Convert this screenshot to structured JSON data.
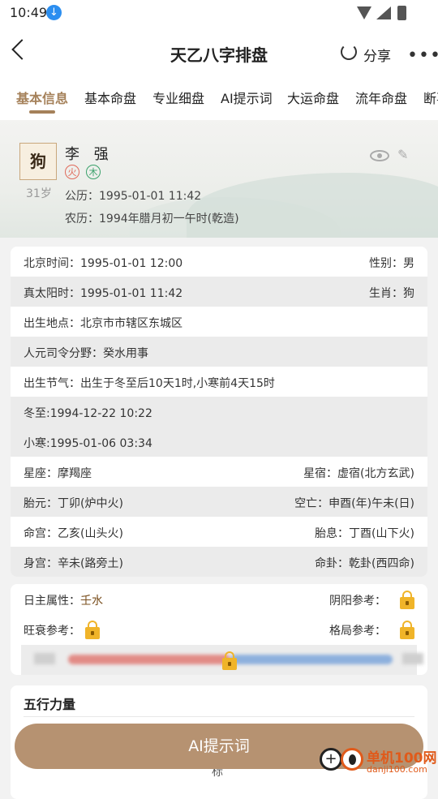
{
  "status_bar": {
    "time": "10:49"
  },
  "header": {
    "title": "天乙八字排盘",
    "share_label": "分享"
  },
  "tabs": [
    {
      "label": "基本信息"
    },
    {
      "label": "基本命盘"
    },
    {
      "label": "专业细盘"
    },
    {
      "label": "AI提示词"
    },
    {
      "label": "大运命盘"
    },
    {
      "label": "流年命盘"
    },
    {
      "label": "断事"
    }
  ],
  "profile": {
    "avatar_text": "狗",
    "age": "31岁",
    "name": "李 强",
    "elements": [
      "火",
      "木"
    ],
    "solar": "公历：1995-01-01 11:42",
    "lunar": "农历：1994年腊月初一午时(乾造)"
  },
  "info_rows": [
    {
      "left": "北京时间：1995-01-01 12:00",
      "right": "性别：男"
    },
    {
      "left": "真太阳时：1995-01-01 11:42",
      "right": "生肖：狗"
    },
    {
      "left": "出生地点：北京市市辖区东城区",
      "right": ""
    },
    {
      "left": "人元司令分野：癸水用事",
      "right": ""
    },
    {
      "left": "出生节气：出生于冬至后10天1时,小寒前4天15时",
      "right": ""
    },
    {
      "left": "冬至:1994-12-22 10:22",
      "right": ""
    },
    {
      "left": "小寒:1995-01-06 03:34",
      "right": ""
    },
    {
      "left": "星座：摩羯座",
      "right": "星宿：虚宿(北方玄武)"
    },
    {
      "left": "胎元：丁卯(炉中火)",
      "right": "空亡：申酉(年)午未(日)"
    },
    {
      "left": "命宫：乙亥(山头火)",
      "right": "胎息：丁酉(山下火)"
    },
    {
      "left": "身宫：辛未(路旁土)",
      "right": "命卦：乾卦(西四命)"
    }
  ],
  "attributes": {
    "day_master_label": "日主属性：",
    "day_master_value": "壬水",
    "yinyang_label": "阴阳参考：",
    "strength_label": "旺衰参考：",
    "pattern_label": "格局参考："
  },
  "five_elements": {
    "title": "五行力量",
    "partial_label": "标"
  },
  "ai_button": {
    "label": "AI提示词"
  },
  "watermark": {
    "line1": "单机100网",
    "line2": "danji100.com"
  }
}
